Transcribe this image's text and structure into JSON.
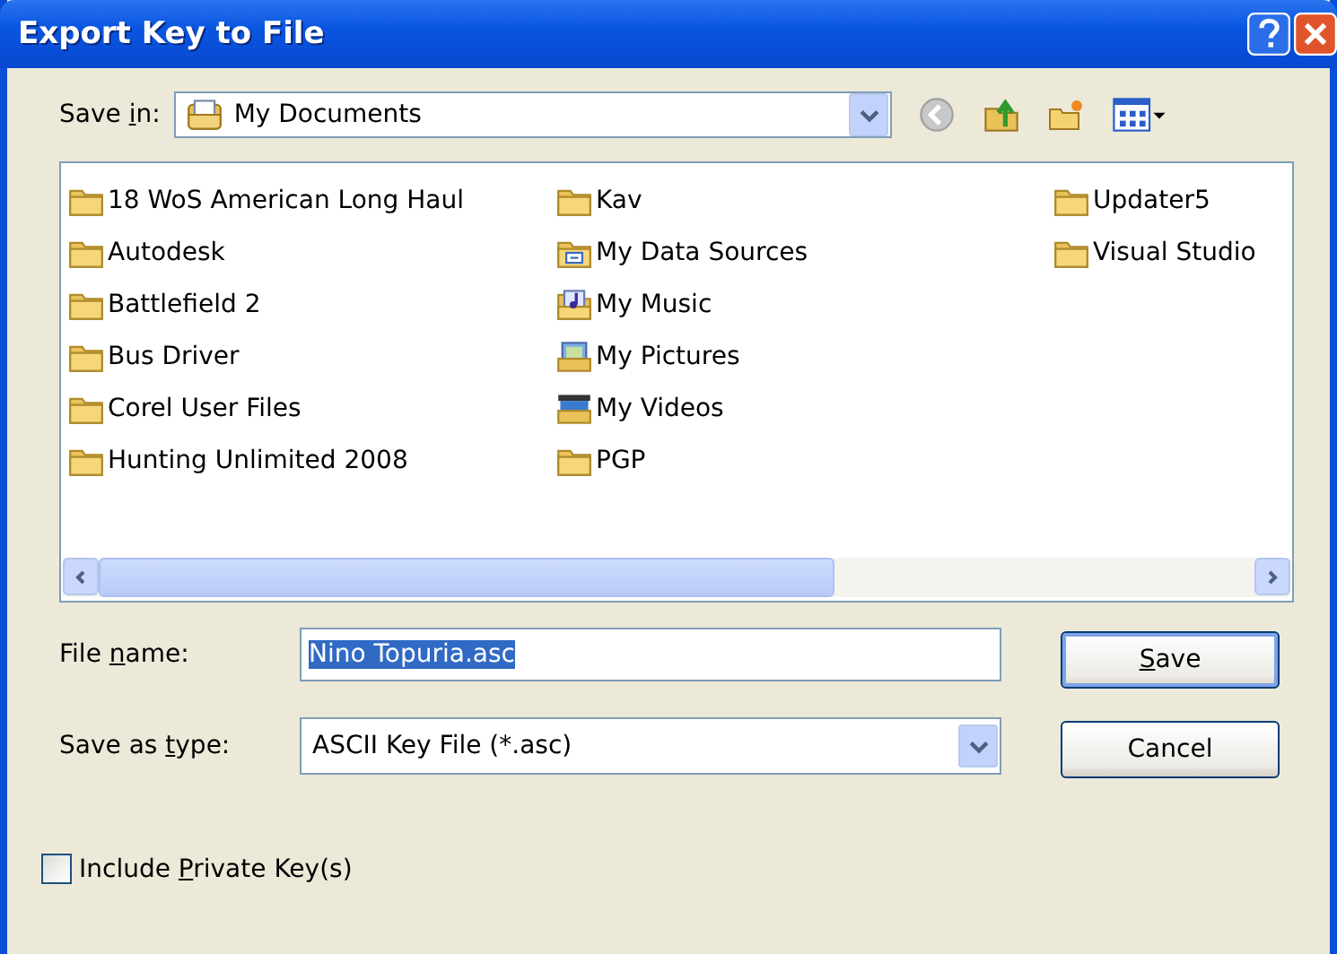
{
  "window": {
    "title": "Export Key to File"
  },
  "save_in": {
    "label": {
      "before": "Save ",
      "key": "i",
      "after": "n:"
    },
    "value": "My Documents"
  },
  "files": {
    "columns": [
      [
        {
          "name": "18 WoS American Long Haul",
          "kind": "folder"
        },
        {
          "name": "Autodesk",
          "kind": "folder"
        },
        {
          "name": "Battlefield 2",
          "kind": "folder"
        },
        {
          "name": "Bus Driver",
          "kind": "folder"
        },
        {
          "name": "Corel User Files",
          "kind": "folder"
        },
        {
          "name": "Hunting Unlimited 2008",
          "kind": "folder"
        }
      ],
      [
        {
          "name": "Kav",
          "kind": "folder"
        },
        {
          "name": "My Data Sources",
          "kind": "datasource"
        },
        {
          "name": "My Music",
          "kind": "music"
        },
        {
          "name": "My Pictures",
          "kind": "pictures"
        },
        {
          "name": "My Videos",
          "kind": "videos"
        },
        {
          "name": "PGP",
          "kind": "folder"
        }
      ],
      [
        {
          "name": "Updater5",
          "kind": "folder"
        },
        {
          "name": "Visual Studio",
          "kind": "folder"
        }
      ]
    ]
  },
  "file_name": {
    "label": {
      "before": "File ",
      "key": "n",
      "after": "ame:"
    },
    "value": "Nino Topuria.asc"
  },
  "save_as_type": {
    "label": {
      "before": "Save as ",
      "key": "t",
      "after": "ype:"
    },
    "value": "ASCII Key File (*.asc)"
  },
  "buttons": [
    {
      "label": {
        "key": "S",
        "after": "ave"
      },
      "default": true
    },
    {
      "label": {
        "after": "Cancel"
      },
      "default": false
    }
  ],
  "include_private_key": {
    "label": {
      "before": "Include ",
      "key": "P",
      "after": "rivate Key(s)"
    },
    "checked": false
  }
}
